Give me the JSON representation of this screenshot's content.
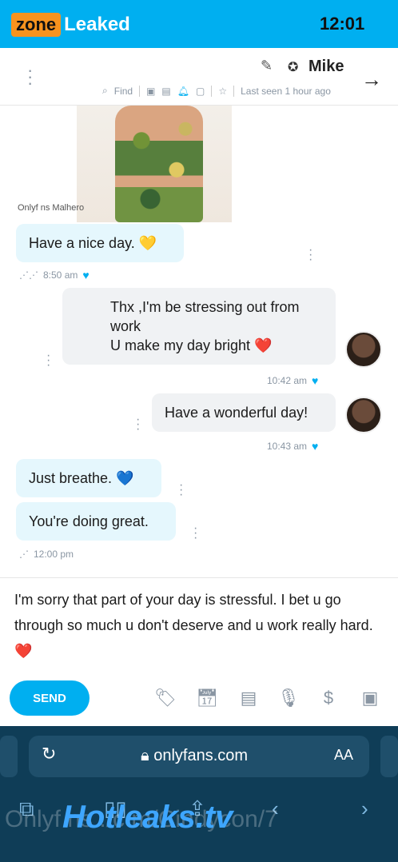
{
  "status_bar": {
    "time": "12:01"
  },
  "watermark_top": {
    "box": "zone",
    "text": "Leaked"
  },
  "header": {
    "name": "Mike",
    "last_seen": "Last seen 1 hour ago",
    "find_label": "Find"
  },
  "photo": {
    "caption": "Onlyf ns Malhero"
  },
  "messages": [
    {
      "side": "in",
      "text": "Have a nice day. 💛",
      "time": "8:50 am"
    },
    {
      "side": "out",
      "lines": [
        "Thx ,I'm be stressing out from",
        "work",
        "U make my day bright ❤️"
      ],
      "time": "10:42 am"
    },
    {
      "side": "out",
      "text": "Have a wonderful day!",
      "time": "10:43 am"
    },
    {
      "side": "in",
      "text": "Just breathe. 💙"
    },
    {
      "side": "in",
      "text": "You're doing great.",
      "time": "12:00 pm"
    }
  ],
  "composer": {
    "text": "I'm sorry that part of your day is stressful. I bet u go through so much u don't deserve and u work really hard. ❤️"
  },
  "send_label": "SEND",
  "browser": {
    "aa_label": "AA",
    "url": "onlyfans.com"
  },
  "watermark_bottom": {
    "text": "Hotleaks.tv",
    "ghost": "Onlyf ns ./c m/Cindycon/7"
  },
  "colors": {
    "accent": "#00aff0",
    "incoming_bubble": "#e5f7fd",
    "outgoing_bubble": "#f0f2f4",
    "watermark_orange": "#f7931e"
  }
}
